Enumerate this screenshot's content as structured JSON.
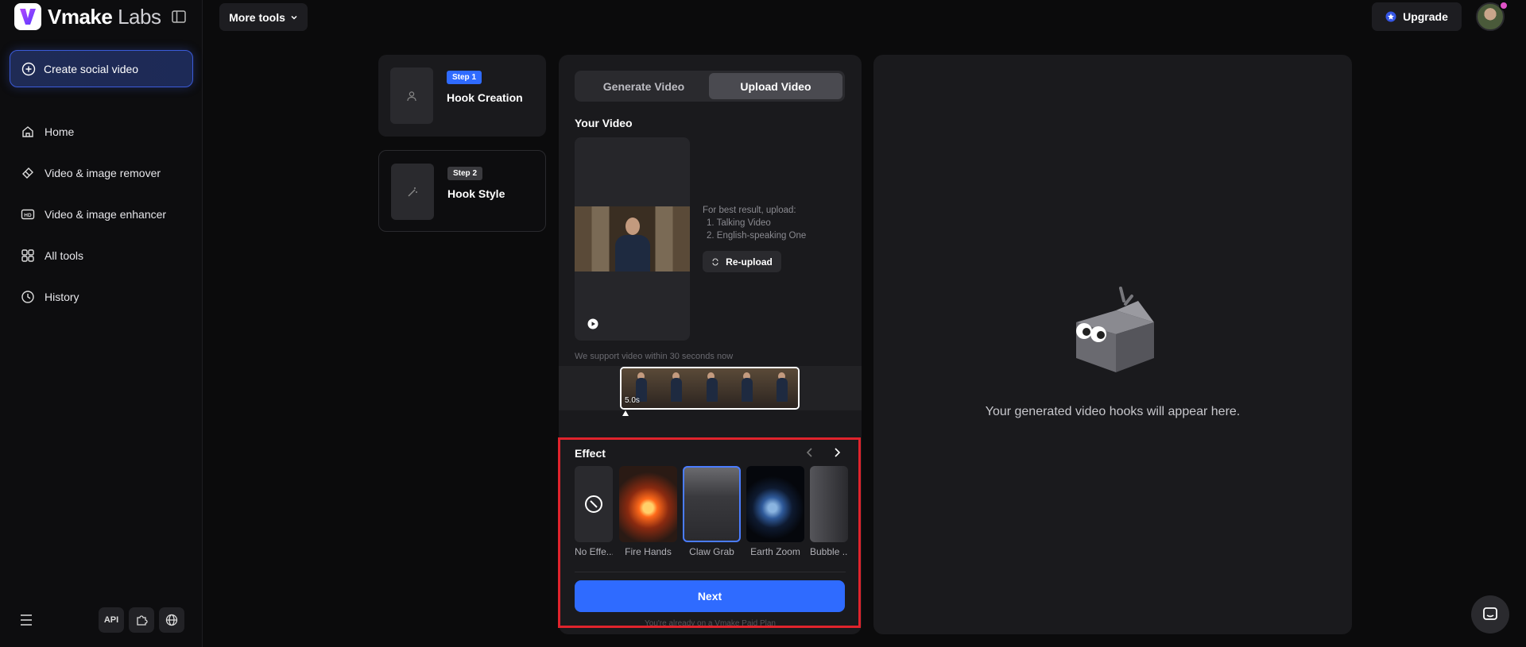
{
  "brand": {
    "name_bold": "Vmake",
    "name_light": "Labs"
  },
  "sidebar": {
    "create_label": "Create social video",
    "items": [
      {
        "label": "Home",
        "icon": "home-icon"
      },
      {
        "label": "Video & image remover",
        "icon": "eraser-icon"
      },
      {
        "label": "Video & image enhancer",
        "icon": "hd-icon"
      },
      {
        "label": "All tools",
        "icon": "grid-icon"
      },
      {
        "label": "History",
        "icon": "clock-icon"
      }
    ],
    "bottom": {
      "api_label": "API"
    }
  },
  "topbar": {
    "more_tools": "More tools",
    "upgrade": "Upgrade"
  },
  "steps": [
    {
      "badge": "Step 1",
      "title": "Hook Creation"
    },
    {
      "badge": "Step 2",
      "title": "Hook Style"
    }
  ],
  "editor": {
    "tabs": [
      {
        "label": "Generate Video"
      },
      {
        "label": "Upload Video"
      }
    ],
    "active_tab": "Upload Video",
    "your_video": "Your Video",
    "hint_title": "For best result, upload:",
    "hint_1": "1. Talking Video",
    "hint_2": "2. English-speaking One",
    "reupload": "Re-upload",
    "support": "We support video within 30 seconds now",
    "duration": "5.0s",
    "effect_title": "Effect",
    "effects": [
      {
        "label": "No Effe..."
      },
      {
        "label": "Fire Hands"
      },
      {
        "label": "Claw Grab"
      },
      {
        "label": "Earth Zoom"
      },
      {
        "label": "Bubble ..."
      }
    ],
    "selected_effect": "Claw Grab",
    "next": "Next",
    "paid_note": "You're already on a Vmake Paid Plan"
  },
  "result": {
    "empty_text": "Your generated video hooks will appear here."
  },
  "colors": {
    "accent": "#2f6bff",
    "highlight": "#e0232c"
  }
}
